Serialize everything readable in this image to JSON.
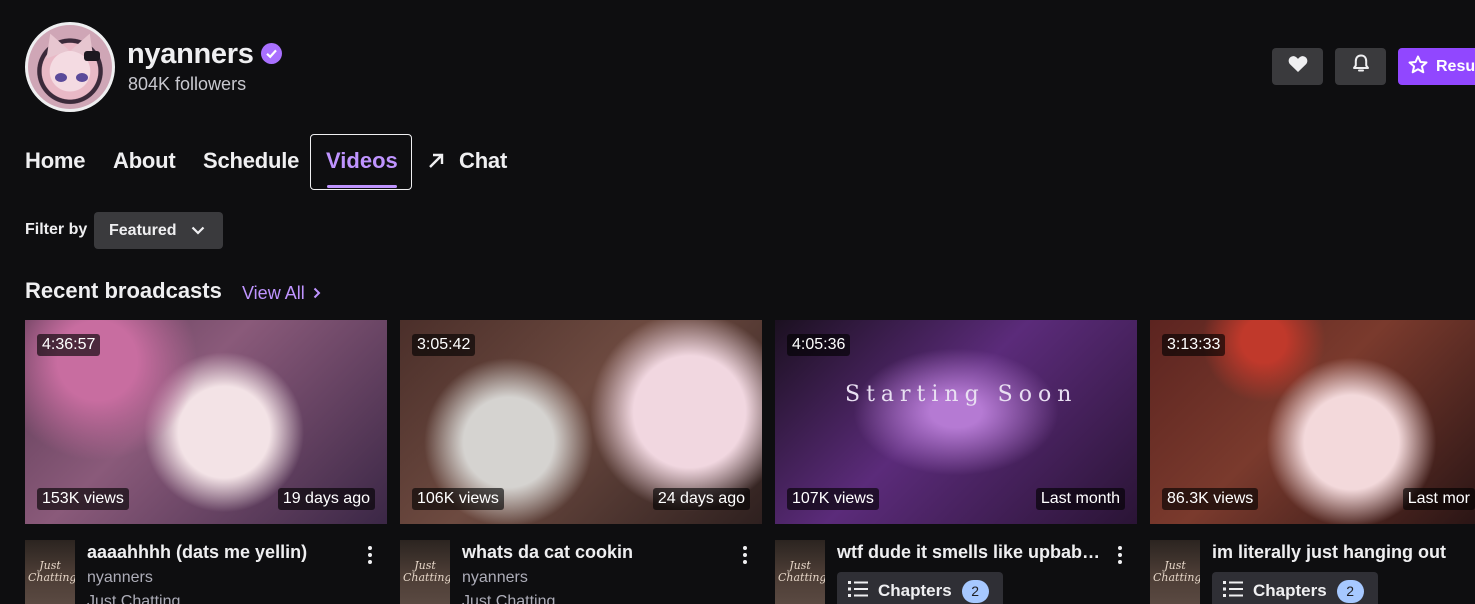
{
  "channel": {
    "name": "nyanners",
    "followers": "804K followers"
  },
  "header_buttons": {
    "heart_icon": "heart-icon",
    "bell_icon": "bell-icon",
    "subscribe_label": "Resu"
  },
  "nav": {
    "home": "Home",
    "about": "About",
    "schedule": "Schedule",
    "videos": "Videos",
    "chat": "Chat"
  },
  "filter": {
    "label": "Filter by",
    "selected": "Featured"
  },
  "section": {
    "title": "Recent broadcasts",
    "view_all": "View All"
  },
  "videos": [
    {
      "duration": "4:36:57",
      "views": "153K views",
      "age": "19 days ago",
      "title": "aaaahhhh (dats me yellin)",
      "channel": "nyanners",
      "category": "Just Chatting",
      "category_thumb": "Just Chatting"
    },
    {
      "duration": "3:05:42",
      "views": "106K views",
      "age": "24 days ago",
      "title": "whats da cat cookin",
      "channel": "nyanners",
      "category": "Just Chatting",
      "category_thumb": "Just Chatting"
    },
    {
      "duration": "4:05:36",
      "views": "107K views",
      "age": "Last month",
      "title": "wtf dude it smells like upbabe ...",
      "chapters_label": "Chapters",
      "chapters_count": "2",
      "category_thumb": "Just Chatting",
      "overlay_text": "Starting Soon"
    },
    {
      "duration": "3:13:33",
      "views": "86.3K views",
      "age": "Last mor",
      "title": "im literally just hanging out",
      "chapters_label": "Chapters",
      "chapters_count": "2",
      "category_thumb": "Just Chatting"
    }
  ],
  "colors": {
    "background": "#0e0e10",
    "accent": "#9147ff",
    "accent_text": "#bf94ff"
  }
}
